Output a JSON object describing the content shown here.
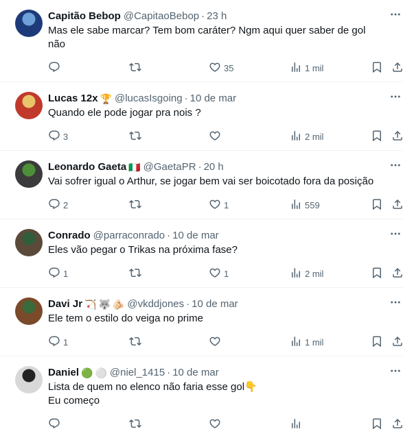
{
  "tweets": [
    {
      "name": "Capitão Bebop",
      "badges": [],
      "handle": "@CapitaoBebop",
      "separator": "·",
      "time": "23 h",
      "text": "Mas ele sabe marcar? Tem bom caráter? Ngm aqui quer saber de gol não",
      "replies": "",
      "retweets": "",
      "likes": "35",
      "views": "1 mil",
      "avatar_colors": [
        "#1d3b7a",
        "#6fa0d8"
      ]
    },
    {
      "name": "Lucas 12x",
      "badges": [
        "🏆"
      ],
      "handle": "@lucasIsgoing",
      "separator": "·",
      "time": "10 de mar",
      "text": "Quando ele pode jogar pra nois ?",
      "replies": "3",
      "retweets": "",
      "likes": "",
      "views": "2 mil",
      "avatar_colors": [
        "#c0392b",
        "#e9c46a"
      ]
    },
    {
      "name": "Leonardo Gaeta",
      "badges": [
        "🇮🇹"
      ],
      "handle": "@GaetaPR",
      "separator": "·",
      "time": "20 h",
      "text": "Vai sofrer igual o Arthur, se jogar bem vai ser boicotado fora da posição",
      "replies": "2",
      "retweets": "",
      "likes": "1",
      "views": "559",
      "avatar_colors": [
        "#3b3b3b",
        "#4e8f3a"
      ]
    },
    {
      "name": "Conrado",
      "badges": [],
      "handle": "@parraconrado",
      "separator": "·",
      "time": "10 de mar",
      "text": "Eles vão pegar o Trikas na próxima fase?",
      "replies": "1",
      "retweets": "",
      "likes": "1",
      "views": "2 mil",
      "avatar_colors": [
        "#5b4a3a",
        "#2f5d3a"
      ]
    },
    {
      "name": "Davi Jr",
      "badges": [
        "🏹",
        "🐺",
        "🫵🏻"
      ],
      "handle": "@vkddjones",
      "separator": "·",
      "time": "10 de mar",
      "text": "Ele tem o estilo do veiga no prime",
      "replies": "1",
      "retweets": "",
      "likes": "",
      "views": "1 mil",
      "avatar_colors": [
        "#7a4a2a",
        "#3a6b3a"
      ]
    },
    {
      "name": "Daniel",
      "badges": [
        "🟢",
        "⚪"
      ],
      "handle": "@niel_1415",
      "separator": "·",
      "time": "10 de mar",
      "text": "Lista de quem no elenco não faria esse gol👇\n Eu começo",
      "replies": "",
      "retweets": "",
      "likes": "",
      "views": "",
      "avatar_colors": [
        "#d8d8d8",
        "#222222"
      ]
    }
  ],
  "icons": {
    "reply": "reply-icon",
    "retweet": "retweet-icon",
    "like": "heart-icon",
    "views": "views-icon",
    "bookmark": "bookmark-icon",
    "share": "share-icon",
    "more": "more-icon"
  },
  "colors": {
    "text": "#0f1419",
    "secondary": "#536471",
    "divider": "#eff3f4"
  }
}
